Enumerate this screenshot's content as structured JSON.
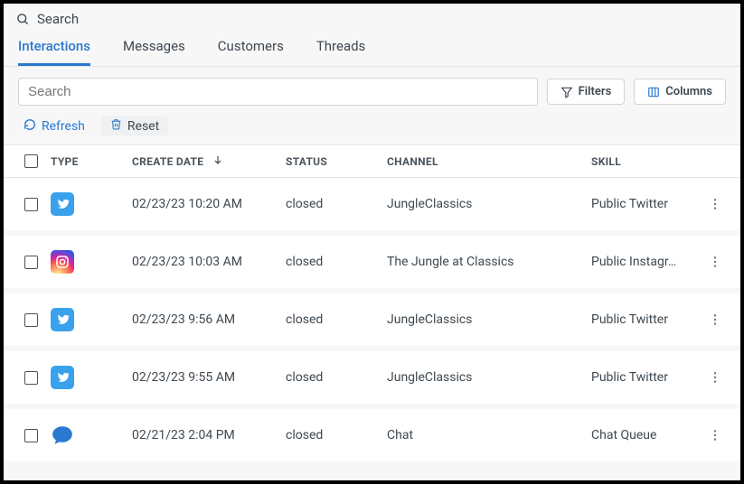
{
  "header": {
    "search_label": "Search"
  },
  "tabs": {
    "interactions": "Interactions",
    "messages": "Messages",
    "customers": "Customers",
    "threads": "Threads"
  },
  "toolbar": {
    "search_placeholder": "Search",
    "filters_label": "Filters",
    "columns_label": "Columns"
  },
  "subtoolbar": {
    "refresh": "Refresh",
    "reset": "Reset"
  },
  "columns": {
    "type": "TYPE",
    "create_date": "CREATE DATE",
    "status": "STATUS",
    "channel": "CHANNEL",
    "skill": "SKILL"
  },
  "rows": [
    {
      "type": "twitter",
      "create_date": "02/23/23 10:20 AM",
      "status": "closed",
      "channel": "JungleClassics",
      "skill": "Public Twitter"
    },
    {
      "type": "instagram",
      "create_date": "02/23/23 10:03 AM",
      "status": "closed",
      "channel": "The Jungle at Classics",
      "skill": "Public Instagr…"
    },
    {
      "type": "twitter",
      "create_date": "02/23/23 9:56 AM",
      "status": "closed",
      "channel": "JungleClassics",
      "skill": "Public Twitter"
    },
    {
      "type": "twitter",
      "create_date": "02/23/23 9:55 AM",
      "status": "closed",
      "channel": "JungleClassics",
      "skill": "Public Twitter"
    },
    {
      "type": "chat",
      "create_date": "02/21/23 2:04 PM",
      "status": "closed",
      "channel": "Chat",
      "skill": "Chat Queue"
    }
  ]
}
